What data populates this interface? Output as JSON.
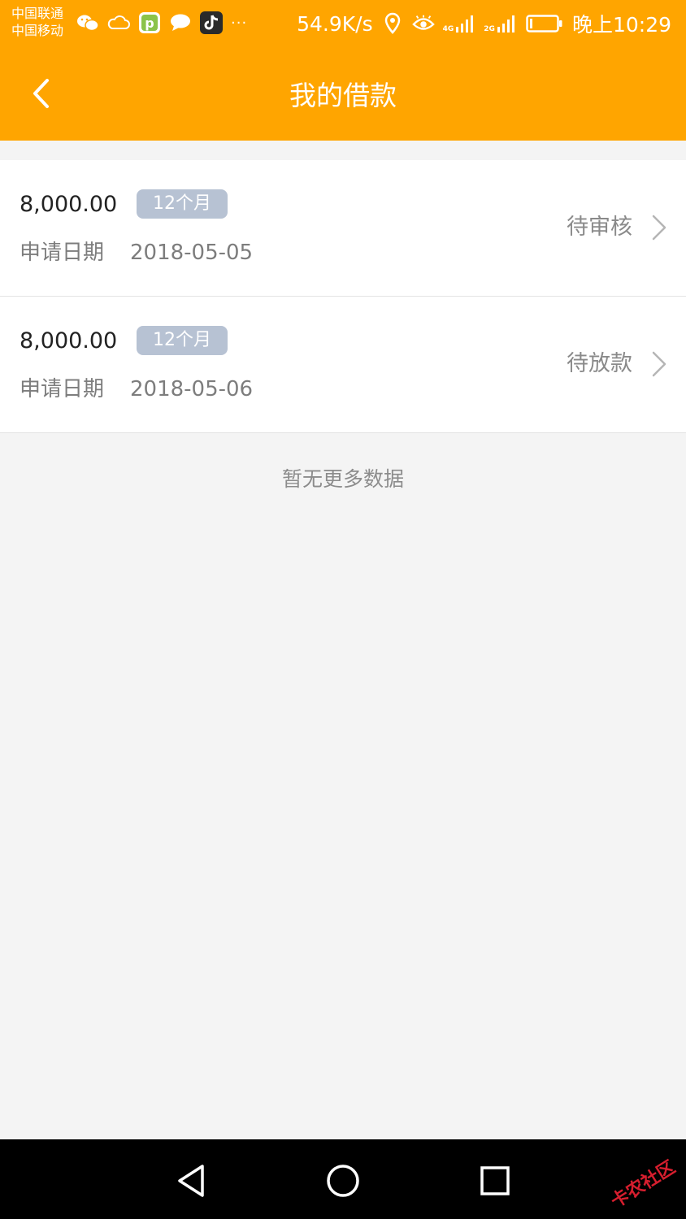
{
  "status_bar": {
    "carrier_1": "中国联通",
    "carrier_2": "中国移动",
    "more": "···",
    "net_speed": "54.9K/s",
    "net_4g": "4G",
    "net_2g": "2G",
    "time": "晚上10:29"
  },
  "header": {
    "title": "我的借款",
    "back_icon": "chevron-left-icon"
  },
  "loans": [
    {
      "amount": "8,000.00",
      "term": "12个月",
      "date_label": "申请日期",
      "date": "2018-05-05",
      "status": "待审核"
    },
    {
      "amount": "8,000.00",
      "term": "12个月",
      "date_label": "申请日期",
      "date": "2018-05-06",
      "status": "待放款"
    }
  ],
  "footer_note": "暂无更多数据",
  "watermark": "卡农社区",
  "colors": {
    "header_bg": "#ffa500",
    "badge_bg": "#b7c2d3",
    "page_bg": "#f4f4f4",
    "nav_bar_bg": "#000000"
  }
}
